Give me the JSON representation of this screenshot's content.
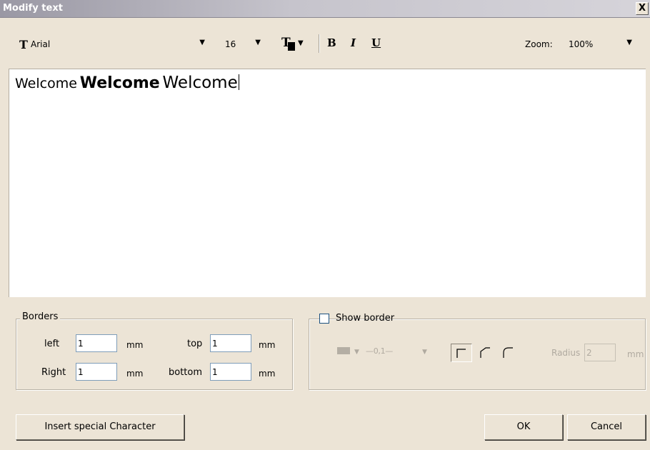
{
  "window": {
    "title": "Modify text",
    "close_glyph": "X"
  },
  "toolbar": {
    "font_name": "Arial",
    "font_size": "16",
    "bold_label": "B",
    "italic_label": "I",
    "underline_label": "U",
    "zoom_label": "Zoom:",
    "zoom_value": "100%"
  },
  "editor": {
    "words": [
      "Welcome",
      "Welcome",
      "Welcome"
    ]
  },
  "borders": {
    "legend": "Borders",
    "left_label": "left",
    "left_value": "1",
    "right_label": "Right",
    "right_value": "1",
    "top_label": "top",
    "top_value": "1",
    "bottom_label": "bottom",
    "bottom_value": "1",
    "unit": "mm"
  },
  "show_border": {
    "label": "Show border",
    "checked": false,
    "line_width": "0,1",
    "radius_label": "Radius",
    "radius_value": "2",
    "radius_unit": "mm"
  },
  "buttons": {
    "insert_special": "Insert special Character",
    "ok": "OK",
    "cancel": "Cancel"
  }
}
